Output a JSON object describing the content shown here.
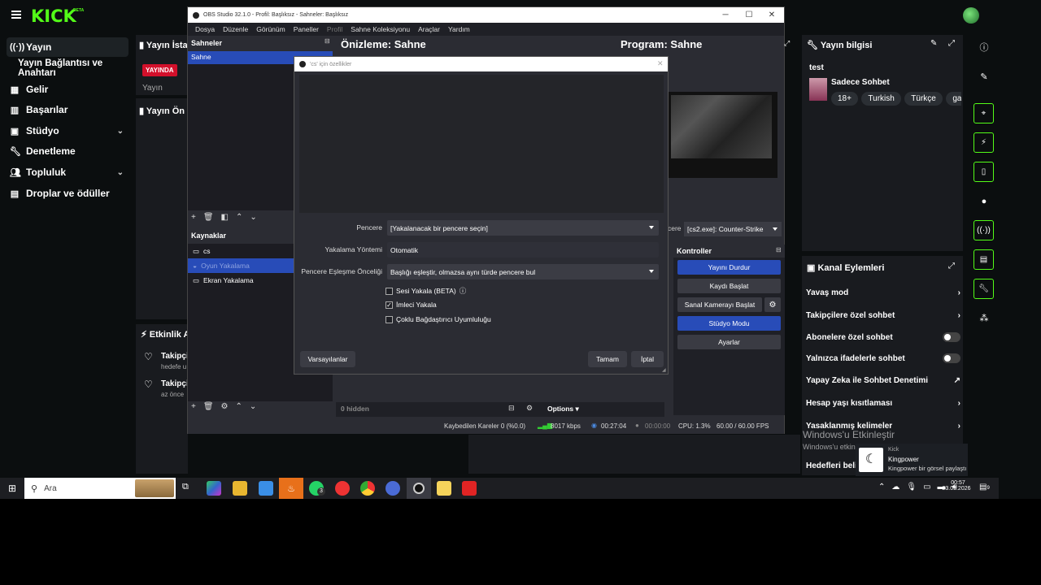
{
  "kick": {
    "brand": "KICK",
    "beta": "BETA",
    "nav": [
      {
        "label": "Yayın",
        "icon": "broadcast-icon"
      },
      {
        "label": "Yayın Bağlantısı ve Anahtarı",
        "icon": ""
      },
      {
        "label": "Gelir",
        "icon": "revenue-icon"
      },
      {
        "label": "Başarılar",
        "icon": "trophy-icon"
      },
      {
        "label": "Stüdyo",
        "icon": "studio-icon"
      },
      {
        "label": "Denetleme",
        "icon": "moderation-icon"
      },
      {
        "label": "Topluluk",
        "icon": "community-icon"
      },
      {
        "label": "Droplar ve ödüller",
        "icon": "gift-icon"
      }
    ],
    "stats_title": "Yayın İsta",
    "live_badge": "YAYINDA",
    "stats_sub": "Yayın",
    "preview_title": "Yayın Ön i",
    "activity_title": "Etkinlik Ak",
    "activity": [
      {
        "title": "Takipçi",
        "sub": "hedefe u"
      },
      {
        "title": "Takipçi",
        "sub": "az önce"
      }
    ],
    "stream_info": {
      "title": "Yayın bilgisi",
      "stream_title": "test",
      "category": "Sadece Sohbet",
      "tags": [
        "18+",
        "Turkish",
        "Türkçe",
        "gaming"
      ]
    },
    "channel_actions": {
      "title": "Kanal Eylemleri",
      "items": [
        {
          "label": "Yavaş mod",
          "control": "chevron"
        },
        {
          "label": "Takipçilere özel sohbet",
          "control": "chevron"
        },
        {
          "label": "Abonelere özel sohbet",
          "control": "toggle"
        },
        {
          "label": "Yalnızca ifadelerle sohbet",
          "control": "toggle"
        },
        {
          "label": "Yapay Zeka ile Sohbet Denetimi",
          "control": "external"
        },
        {
          "label": "Hesap yaşı kısıtlaması",
          "control": "chevron"
        },
        {
          "label": "Yasaklanmış kelimeler",
          "control": "chevron"
        },
        {
          "label": "Hedefleri beli",
          "control": ""
        }
      ]
    },
    "windows_activation": {
      "title": "Windows'u Etkinleştir",
      "sub": "Windows'u etkinleştirmek için Ayarlar'a gidin."
    },
    "notification": {
      "app": "Kingpower",
      "text": "Kingpower bir görsel paylaştı",
      "brand": "Kick"
    }
  },
  "obs": {
    "title": "OBS Studio 32.1.0 - Profil: Başlıksız - Sahneler: Başlıksız",
    "menu": [
      "Dosya",
      "Düzenle",
      "Görünüm",
      "Paneller",
      "Profil",
      "Sahne Koleksiyonu",
      "Araçlar",
      "Yardım"
    ],
    "scenes_title": "Sahneler",
    "scenes": [
      "Sahne"
    ],
    "sources_title": "Kaynaklar",
    "sources": [
      {
        "label": "cs",
        "icon": "window-capture-icon"
      },
      {
        "label": "Oyun Yakalama",
        "icon": "gamepad-icon"
      },
      {
        "label": "Ekran Yakalama",
        "icon": "monitor-icon"
      }
    ],
    "preview_label": "Önizleme: Sahne",
    "program_label": "Program: Sahne",
    "window_select": "[cs2.exe]: Counter-Strike",
    "window_prefix": "cere",
    "controls_title": "Kontroller",
    "controls": [
      "Yayını Durdur",
      "Kaydı Başlat",
      "Sanal Kamerayı Başlat",
      "Stüdyo Modu",
      "Ayarlar"
    ],
    "mixer_hidden": "0 hidden",
    "options_label": "Options",
    "status": {
      "dropped": "Kaybedilen Kareler 0 (%0.0)",
      "bitrate": "8017 kbps",
      "live_time": "00:27:04",
      "rec_time": "00:00:00",
      "cpu": "CPU: 1.3%",
      "fps": "60.00 / 60.00 FPS"
    }
  },
  "dialog": {
    "title": "'cs' için özellikler",
    "fields": [
      {
        "label": "Pencere",
        "value": "[Yakalanacak bir pencere seçin]"
      },
      {
        "label": "Yakalama Yöntemi",
        "value": "Otomatik"
      },
      {
        "label": "Pencere Eşleşme Önceliği",
        "value": "Başlığı eşleştir, olmazsa aynı türde pencere bul"
      }
    ],
    "checkboxes": [
      {
        "label": "Sesi Yakala (BETA)",
        "checked": false
      },
      {
        "label": "İmleci Yakala",
        "checked": true
      },
      {
        "label": "Çoklu Bağdaştırıcı Uyumluluğu",
        "checked": false
      }
    ],
    "defaults_button": "Varsayılanlar",
    "ok_button": "Tamam",
    "cancel_button": "İptal"
  },
  "taskbar": {
    "search_placeholder": "Ara",
    "time": "00:57",
    "date": "23.03.2026",
    "whatsapp_badge": "3",
    "notif_badge": "9"
  },
  "colors": {
    "kick_green": "#53fc18",
    "live_red": "#d3102b",
    "obs_blue": "#284cb8"
  }
}
